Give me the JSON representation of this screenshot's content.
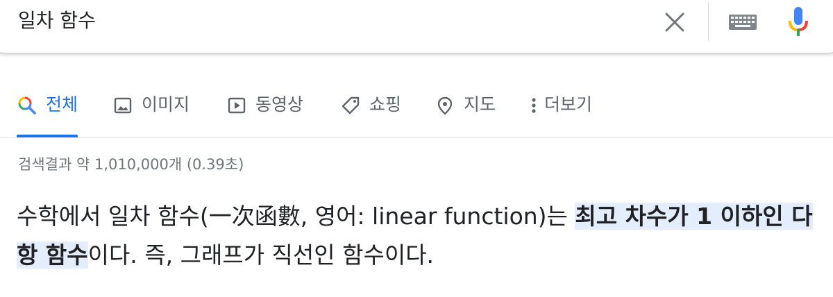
{
  "search": {
    "query": "일차 함수",
    "clear_icon": "close-icon",
    "keyboard_icon": "keyboard-icon",
    "mic_icon": "microphone-icon"
  },
  "tabs": [
    {
      "label": "전체",
      "icon": "search-icon",
      "active": true
    },
    {
      "label": "이미지",
      "icon": "image-icon",
      "active": false
    },
    {
      "label": "동영상",
      "icon": "play-icon",
      "active": false
    },
    {
      "label": "쇼핑",
      "icon": "tag-icon",
      "active": false
    },
    {
      "label": "지도",
      "icon": "map-pin-icon",
      "active": false
    },
    {
      "label": "더보기",
      "icon": "more-vert-icon",
      "active": false
    }
  ],
  "results": {
    "stats": "검색결과 약 1,010,000개 (0.39초)"
  },
  "snippet": {
    "part1": "수학에서 일차 함수(一次函數, 영어: linear function)는 ",
    "highlight": "최고 차수가 1 이하인 다항 함수",
    "part2": "이다. 즉, 그래프가 직선인 함수이다."
  },
  "colors": {
    "accent": "#1a73e8",
    "highlight_bg": "#e3edfb",
    "text": "#202124",
    "muted": "#5f6368"
  }
}
